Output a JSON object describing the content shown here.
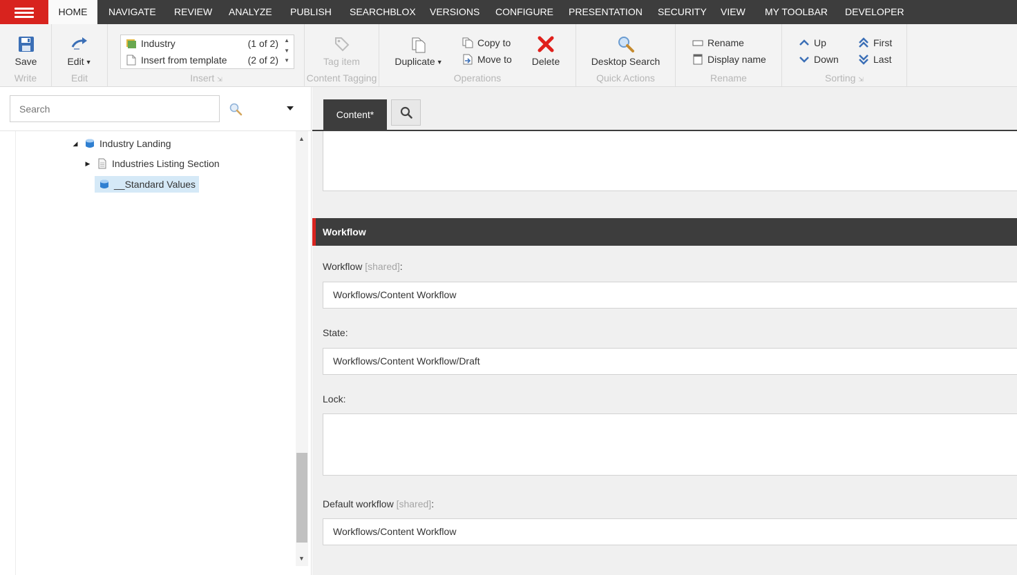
{
  "topnav": {
    "tabs": [
      "HOME",
      "NAVIGATE",
      "REVIEW",
      "ANALYZE",
      "PUBLISH",
      "SEARCHBLOX",
      "VERSIONS",
      "CONFIGURE",
      "PRESENTATION",
      "SECURITY",
      "VIEW",
      "MY TOOLBAR",
      "DEVELOPER"
    ],
    "active_tab": "HOME",
    "menu_color": "#d8231e"
  },
  "ribbon": {
    "write": {
      "label": "Write",
      "save": "Save"
    },
    "edit": {
      "label": "Edit",
      "edit": "Edit"
    },
    "insert": {
      "label": "Insert",
      "items": [
        {
          "name": "Industry",
          "count": "(1 of 2)"
        },
        {
          "name": "Insert from template",
          "count": "(2 of 2)"
        }
      ]
    },
    "tagging": {
      "label": "Content Tagging",
      "tag_item": "Tag item"
    },
    "operations": {
      "label": "Operations",
      "duplicate": "Duplicate",
      "copy_to": "Copy to",
      "move_to": "Move to",
      "delete": "Delete"
    },
    "quick_actions": {
      "label": "Quick Actions",
      "desktop_search": "Desktop Search"
    },
    "rename": {
      "label": "Rename",
      "rename": "Rename",
      "display_name": "Display name"
    },
    "sorting": {
      "label": "Sorting",
      "up": "Up",
      "down": "Down",
      "first": "First",
      "last": "Last"
    }
  },
  "tree": {
    "search_placeholder": "Search",
    "nodes": [
      {
        "label": "Industry Landing",
        "expander": "expanded",
        "icon": "template-icon"
      },
      {
        "label": "Industries Listing Section",
        "expander": "collapsed",
        "icon": "document-icon"
      },
      {
        "label": "__Standard Values",
        "expander": "none",
        "icon": "template-icon",
        "selected": true
      }
    ]
  },
  "editor": {
    "tab_content": "Content*",
    "section_title": "Workflow",
    "fields": {
      "workflow": {
        "label": "Workflow",
        "shared": "[shared]",
        "value": "Workflows/Content Workflow"
      },
      "state": {
        "label": "State:",
        "value": "Workflows/Content Workflow/Draft"
      },
      "lock": {
        "label": "Lock:",
        "value": ""
      },
      "default_workflow": {
        "label": "Default workflow",
        "shared": "[shared]",
        "value": "Workflows/Content Workflow"
      }
    }
  },
  "colors": {
    "accent": "#d8231e",
    "dark": "#3d3d3d",
    "selection": "#d5e9f7",
    "save_blue": "#3b6fb6"
  }
}
